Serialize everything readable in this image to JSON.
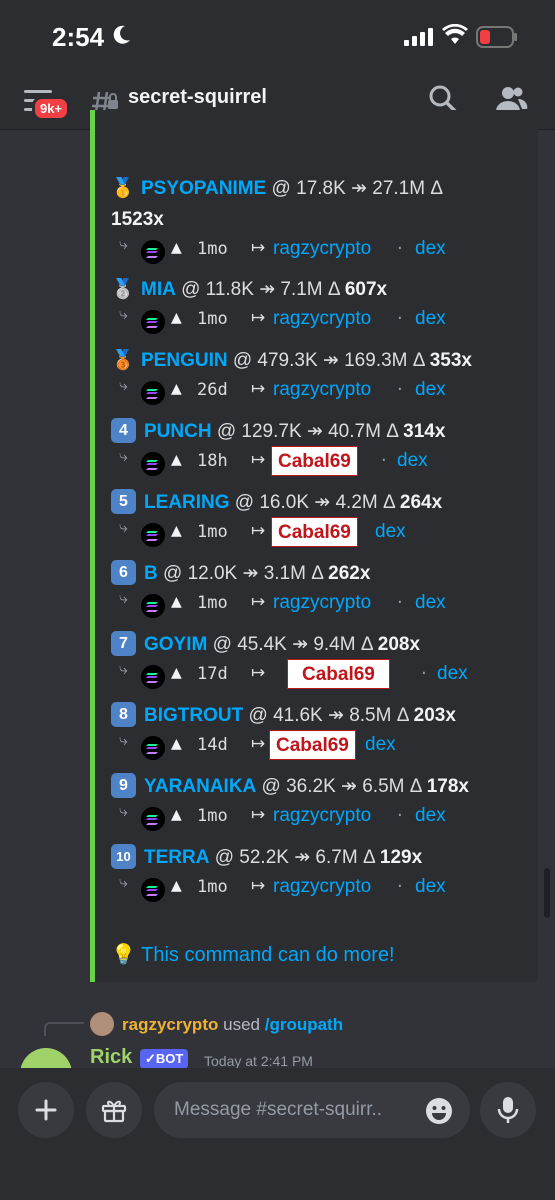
{
  "status_bar": {
    "time": "2:54"
  },
  "header": {
    "badge": "9k+",
    "channel": "secret-squirrel"
  },
  "entries": [
    {
      "icon": "🥇",
      "ticker": "PSYOPANIME",
      "stats": " @ 17.8K ↠ 27.1M Δ ",
      "mult": "1523x",
      "age": "1mo",
      "caller": "ragzycrypto",
      "dex": "dex"
    },
    {
      "icon": "🥈",
      "ticker": "MIA",
      "stats": " @ 11.8K ↠ 7.1M Δ ",
      "mult": "607x",
      "age": "1mo",
      "caller": "ragzycrypto",
      "dex": "dex"
    },
    {
      "icon": "🥉",
      "ticker": "PENGUIN",
      "stats": " @ 479.3K ↠ 169.3M Δ ",
      "mult": "353x",
      "age": "26d",
      "caller": "ragzycrypto",
      "dex": "dex"
    },
    {
      "icon": "4",
      "ticker": "PUNCH",
      "stats": " @ 129.7K ↠ 40.7M Δ ",
      "mult": "314x",
      "age": "18h",
      "caller": "Cabal69",
      "dex": "dex"
    },
    {
      "icon": "5",
      "ticker": "LEARING",
      "stats": " @ 16.0K ↠ 4.2M Δ ",
      "mult": "264x",
      "age": "1mo",
      "caller": "Cabal69",
      "dex": "dex"
    },
    {
      "icon": "6",
      "ticker": "B",
      "stats": " @ 12.0K ↠ 3.1M Δ ",
      "mult": "262x",
      "age": "1mo",
      "caller": "ragzycrypto",
      "dex": "dex"
    },
    {
      "icon": "7",
      "ticker": "GOYIM",
      "stats": " @ 45.4K ↠ 9.4M Δ ",
      "mult": "208x",
      "age": "17d",
      "caller": "Cabal69",
      "dex": "dex"
    },
    {
      "icon": "8",
      "ticker": "BIGTROUT",
      "stats": " @ 41.6K ↠ 8.5M Δ ",
      "mult": "203x",
      "age": "14d",
      "caller": "Cabal69",
      "dex": "dex"
    },
    {
      "icon": "9",
      "ticker": "YARANAIKA",
      "stats": " @ 36.2K ↠ 6.5M Δ ",
      "mult": "178x",
      "age": "1mo",
      "caller": "ragzycrypto",
      "dex": "dex"
    },
    {
      "icon": "10",
      "ticker": "TERRA",
      "stats": " @ 52.2K ↠ 6.7M Δ ",
      "mult": "129x",
      "age": "1mo",
      "caller": "ragzycrypto",
      "dex": "dex"
    }
  ],
  "more_text": "This command can do more!",
  "reply": {
    "user": "ragzycrypto",
    "used": "used",
    "command": "/groupath"
  },
  "next_message": {
    "author": "Rick",
    "bot_tag": "✓BOT",
    "timestamp": "Today at 2:41 PM"
  },
  "composer": {
    "placeholder": "Message #secret-squirr.."
  },
  "colors": {
    "link": "#00a8fc",
    "embed_border": "#6ad14b",
    "cabal_red": "#c0151a"
  }
}
